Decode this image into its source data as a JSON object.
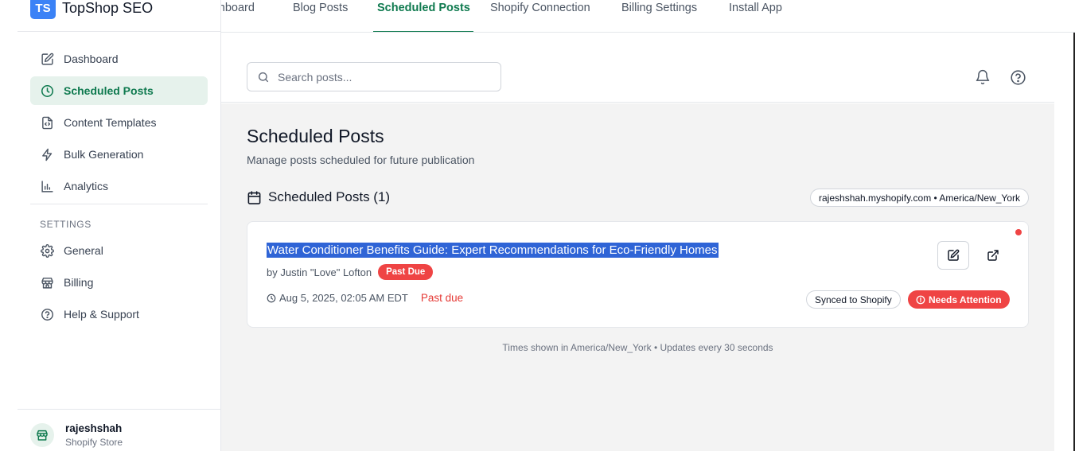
{
  "app": {
    "badge": "TS",
    "name": "TopShop SEO"
  },
  "topnav": {
    "tabs": [
      {
        "label": "Dashboard"
      },
      {
        "label": "Blog Posts"
      },
      {
        "label": "Scheduled Posts"
      },
      {
        "label": "Shopify Connection"
      },
      {
        "label": "Billing Settings"
      },
      {
        "label": "Install App"
      }
    ]
  },
  "sidebar": {
    "items": [
      {
        "label": "Dashboard",
        "icon": "edit-square-icon"
      },
      {
        "label": "Scheduled Posts",
        "icon": "clock-icon"
      },
      {
        "label": "Content Templates",
        "icon": "file-code-icon"
      },
      {
        "label": "Bulk Generation",
        "icon": "lightning-icon"
      },
      {
        "label": "Analytics",
        "icon": "bar-chart-icon"
      }
    ],
    "settings_label": "SETTINGS",
    "settings_items": [
      {
        "label": "General",
        "icon": "gear-icon"
      },
      {
        "label": "Billing",
        "icon": "store-icon"
      },
      {
        "label": "Help & Support",
        "icon": "help-circle-icon"
      }
    ],
    "user": {
      "name": "rajeshshah",
      "subtitle": "Shopify Store"
    }
  },
  "header": {
    "search_placeholder": "Search posts..."
  },
  "main": {
    "title": "Scheduled Posts",
    "subtitle": "Manage posts scheduled for future publication",
    "section_title": "Scheduled Posts (1)",
    "store_chip": "rajeshshah.myshopify.com • America/New_York",
    "posts": [
      {
        "title": "Water Conditioner Benefits Guide: Expert Recommendations for Eco-Friendly Homes",
        "author": "by Justin \"Love\" Lofton",
        "status_badge": "Past Due",
        "date": "Aug 5, 2025, 02:05 AM EDT",
        "due_text": "Past due",
        "sync_chip": "Synced to Shopify",
        "attention_chip": "Needs Attention"
      }
    ],
    "footer_note": "Times shown in America/New_York • Updates every 30 seconds"
  },
  "colors": {
    "accent": "#0f7a4f",
    "danger": "#ef4444",
    "brand": "#3b82f6",
    "selection": "#2f64d6"
  }
}
